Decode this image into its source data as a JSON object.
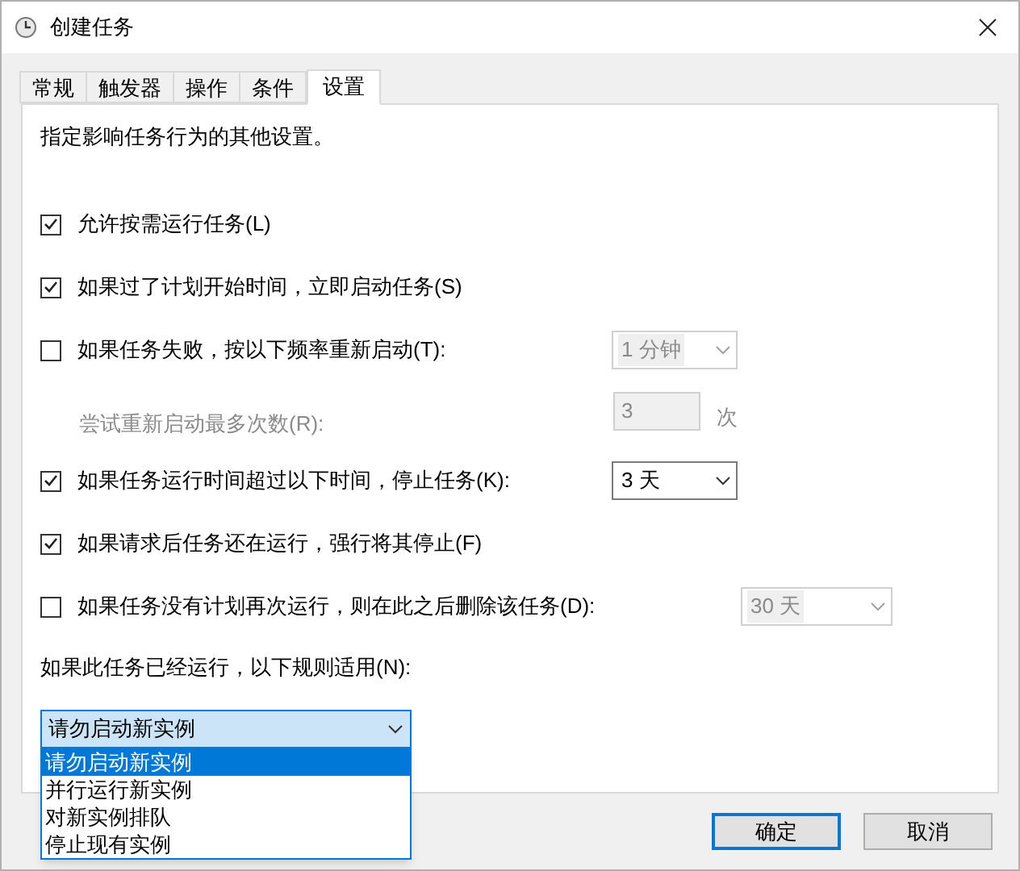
{
  "window": {
    "title": "创建任务"
  },
  "tabs": [
    {
      "label": "常规",
      "selected": false
    },
    {
      "label": "触发器",
      "selected": false
    },
    {
      "label": "操作",
      "selected": false
    },
    {
      "label": "条件",
      "selected": false
    },
    {
      "label": "设置",
      "selected": true
    }
  ],
  "description": "指定影响任务行为的其他设置。",
  "options": [
    {
      "kind": "checkbox",
      "label": "允许按需运行任务(L)",
      "checked": true
    },
    {
      "kind": "checkbox",
      "label": "如果过了计划开始时间，立即启动任务(S)",
      "checked": true
    },
    {
      "kind": "checkbox",
      "label": "如果任务失败，按以下频率重新启动(T):",
      "checked": false,
      "control": {
        "kind": "select",
        "value": "1 分钟",
        "disabled": true
      }
    },
    {
      "kind": "sub",
      "label": "尝试重新启动最多次数(R):",
      "disabled": true,
      "control": {
        "kind": "input",
        "value": "3",
        "disabled": true,
        "suffix": "次"
      }
    },
    {
      "kind": "checkbox",
      "label": "如果任务运行时间超过以下时间，停止任务(K):",
      "checked": true,
      "control": {
        "kind": "select",
        "value": "3 天",
        "disabled": false
      }
    },
    {
      "kind": "checkbox",
      "label": "如果请求后任务还在运行，强行将其停止(F)",
      "checked": true
    },
    {
      "kind": "checkbox",
      "label": "如果任务没有计划再次运行，则在此之后删除该任务(D):",
      "checked": false,
      "control": {
        "kind": "select",
        "value": "30 天",
        "disabled": true,
        "wide": true
      }
    }
  ],
  "rule_label": "如果此任务已经运行，以下规则适用(N):",
  "rule_select": {
    "value": "请勿启动新实例",
    "expanded": true,
    "options": [
      {
        "label": "请勿启动新实例",
        "selected": true
      },
      {
        "label": "并行运行新实例",
        "selected": false
      },
      {
        "label": "对新实例排队",
        "selected": false
      },
      {
        "label": "停止现有实例",
        "selected": false
      }
    ]
  },
  "buttons": [
    {
      "label": "确定",
      "default": true
    },
    {
      "label": "取消",
      "default": false
    }
  ]
}
